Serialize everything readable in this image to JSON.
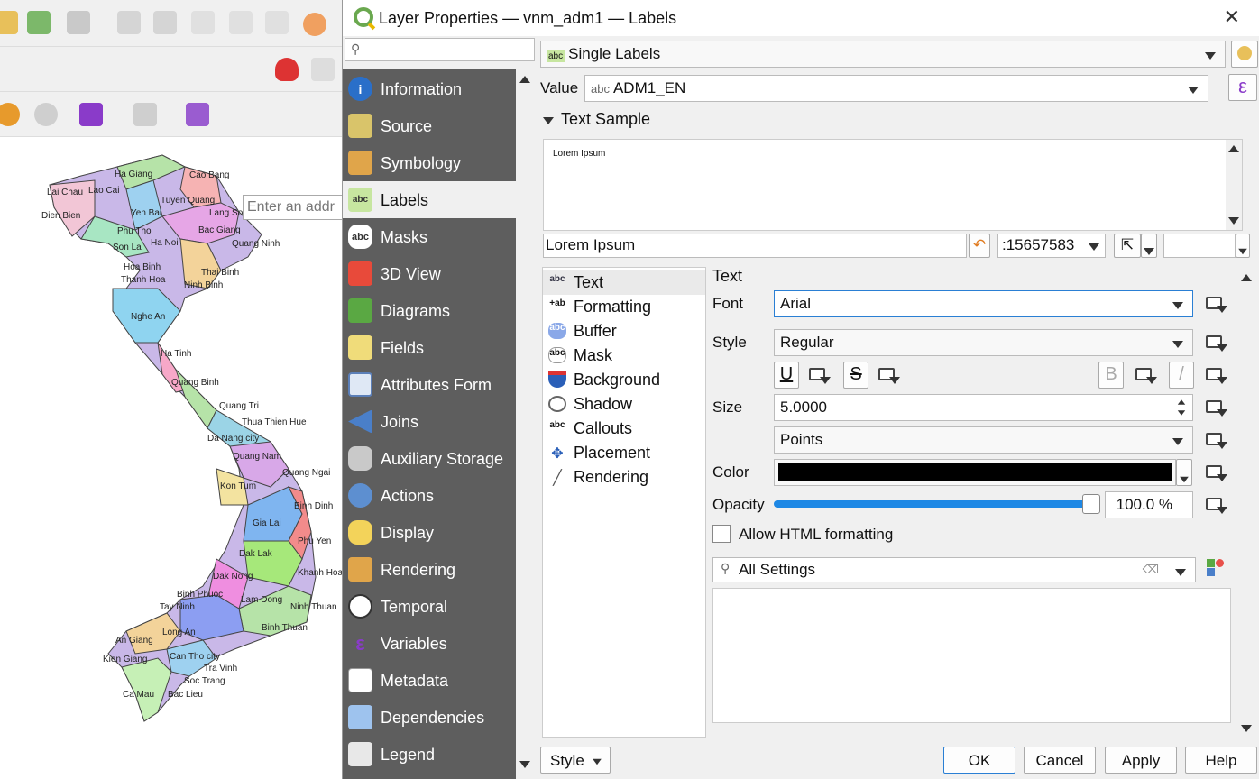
{
  "window": {
    "title": "Layer Properties — vnm_adm1 — Labels"
  },
  "map": {
    "address_placeholder": "Enter an addr",
    "labels": [
      "Ha Giang",
      "Cao Bang",
      "Lai Chau",
      "Lao Cai",
      "Tuyen Quang",
      "Dien Bien",
      "Yen Bai",
      "Lang Son",
      "Phu Tho",
      "Bac Giang",
      "Son La",
      "Ha Noi",
      "Quang Ninh",
      "Hoa Binh",
      "Thai Binh",
      "Thanh Hoa",
      "Ninh Binh",
      "Nghe An",
      "Ha Tinh",
      "Quang Binh",
      "Quang Tri",
      "Thua Thien Hue",
      "Da Nang city",
      "Quang Nam",
      "Quang Ngai",
      "Kon Tum",
      "Binh Dinh",
      "Gia Lai",
      "Phu Yen",
      "Dak Lak",
      "Khanh Hoa",
      "Dak Nong",
      "Binh Phuoc",
      "Tay Ninh",
      "Lam Dong",
      "Ninh Thuan",
      "Binh Thuan",
      "Long An",
      "An Giang",
      "Can Tho city",
      "Kien Giang",
      "Tra Vinh",
      "Soc Trang",
      "Ca Mau",
      "Bac Lieu"
    ]
  },
  "sidebar": {
    "search_placeholder": "",
    "items": [
      {
        "label": "Information",
        "icon": "info-icon"
      },
      {
        "label": "Source",
        "icon": "source-icon"
      },
      {
        "label": "Symbology",
        "icon": "symbology-icon"
      },
      {
        "label": "Labels",
        "icon": "labels-icon"
      },
      {
        "label": "Masks",
        "icon": "masks-icon"
      },
      {
        "label": "3D View",
        "icon": "3d-view-icon"
      },
      {
        "label": "Diagrams",
        "icon": "diagrams-icon"
      },
      {
        "label": "Fields",
        "icon": "fields-icon"
      },
      {
        "label": "Attributes Form",
        "icon": "attributes-form-icon"
      },
      {
        "label": "Joins",
        "icon": "joins-icon"
      },
      {
        "label": "Auxiliary Storage",
        "icon": "auxiliary-storage-icon"
      },
      {
        "label": "Actions",
        "icon": "actions-icon"
      },
      {
        "label": "Display",
        "icon": "display-icon"
      },
      {
        "label": "Rendering",
        "icon": "rendering-icon"
      },
      {
        "label": "Temporal",
        "icon": "temporal-icon"
      },
      {
        "label": "Variables",
        "icon": "variables-icon"
      },
      {
        "label": "Metadata",
        "icon": "metadata-icon"
      },
      {
        "label": "Dependencies",
        "icon": "dependencies-icon"
      },
      {
        "label": "Legend",
        "icon": "legend-icon"
      }
    ],
    "selected": "Labels"
  },
  "labels_panel": {
    "mode": "Single Labels",
    "mode_icon_text": "abc",
    "value_label": "Value",
    "value_prefix": "abc",
    "value": "ADM1_EN",
    "expression_symbol": "ε",
    "text_sample_header": "Text Sample",
    "preview_text": "Lorem Ipsum",
    "sample_input": "Lorem Ipsum",
    "scale": ":15657583",
    "subnav": [
      {
        "label": "Text",
        "icon": "abc"
      },
      {
        "label": "Formatting",
        "icon": "+ab"
      },
      {
        "label": "Buffer",
        "icon": "abc"
      },
      {
        "label": "Mask",
        "icon": "abc"
      },
      {
        "label": "Background",
        "icon": ""
      },
      {
        "label": "Shadow",
        "icon": ""
      },
      {
        "label": "Callouts",
        "icon": "abc"
      },
      {
        "label": "Placement",
        "icon": ""
      },
      {
        "label": "Rendering",
        "icon": ""
      }
    ],
    "section_title": "Text",
    "font_label": "Font",
    "font": "Arial",
    "style_label": "Style",
    "style": "Regular",
    "underline_glyph": "U",
    "strike_glyph": "S",
    "bold_glyph": "B",
    "italic_glyph": "/",
    "size_label": "Size",
    "size": "5.0000",
    "unit": "Points",
    "color_label": "Color",
    "color": "#000000",
    "opacity_label": "Opacity",
    "opacity_value": "100.0 %",
    "opacity_fraction": 1.0,
    "html_checkbox_label": "Allow HTML formatting",
    "html_checked": false,
    "settings_search": "All Settings"
  },
  "footer": {
    "style_button": "Style",
    "ok": "OK",
    "cancel": "Cancel",
    "apply": "Apply",
    "help": "Help"
  }
}
